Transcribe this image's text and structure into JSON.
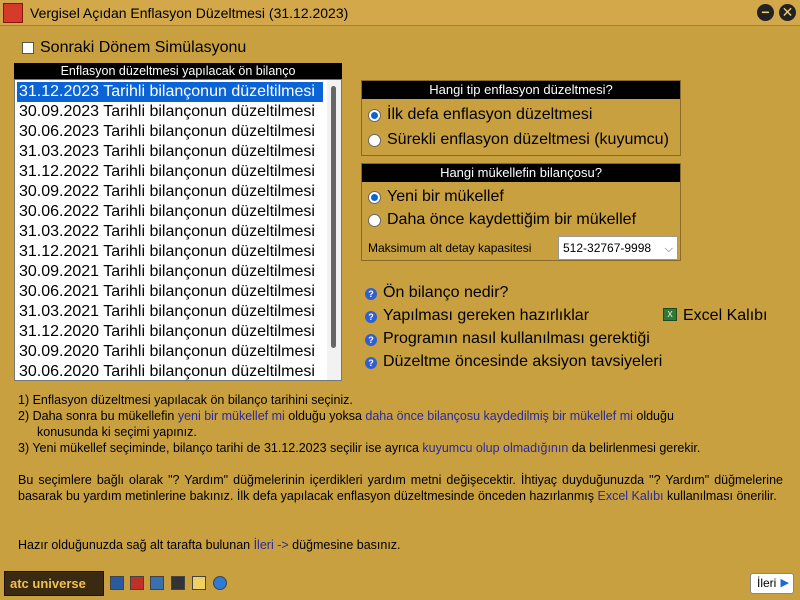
{
  "window": {
    "title": "Vergisel Açıdan Enflasyon Düzeltmesi (31.12.2023)",
    "minimize_glyph": "−",
    "close_glyph": "✕"
  },
  "simulation": {
    "label": "Sonraki Dönem Simülasyonu",
    "checked": false
  },
  "balance_list": {
    "header": "Enflasyon düzeltmesi yapılacak ön bilanço",
    "selected_index": 0,
    "items": [
      "31.12.2023 Tarihli bilançonun düzeltilmesi",
      "30.09.2023 Tarihli bilançonun düzeltilmesi",
      "30.06.2023 Tarihli bilançonun düzeltilmesi",
      "31.03.2023 Tarihli bilançonun düzeltilmesi",
      "31.12.2022 Tarihli bilançonun düzeltilmesi",
      "30.09.2022 Tarihli bilançonun düzeltilmesi",
      "30.06.2022 Tarihli bilançonun düzeltilmesi",
      "31.03.2022 Tarihli bilançonun düzeltilmesi",
      "31.12.2021 Tarihli bilançonun düzeltilmesi",
      "30.09.2021 Tarihli bilançonun düzeltilmesi",
      "30.06.2021 Tarihli bilançonun düzeltilmesi",
      "31.03.2021 Tarihli bilançonun düzeltilmesi",
      "31.12.2020 Tarihli bilançonun düzeltilmesi",
      "30.09.2020 Tarihli bilançonun düzeltilmesi",
      "30.06.2020 Tarihli bilançonun düzeltilmesi"
    ]
  },
  "type_panel": {
    "header": "Hangi tip enflasyon düzeltmesi?",
    "options": [
      "İlk defa enflasyon düzeltmesi",
      "Sürekli enflasyon düzeltmesi (kuyumcu)"
    ],
    "selected": 0
  },
  "taxpayer_panel": {
    "header": "Hangi mükellefin bilançosu?",
    "options": [
      "Yeni bir mükellef",
      "Daha önce kaydettiğim bir mükellef"
    ],
    "selected": 0,
    "capacity_label": "Maksimum alt detay kapasitesi",
    "capacity_value": "512-32767-9998",
    "chevron_glyph": "⌵"
  },
  "help_links": {
    "icon_glyph": "?",
    "items": [
      "Ön bilanço nedir?",
      "Yapılması gereken hazırlıklar",
      "Programın nasıl kullanılması gerektiği",
      "Düzeltme öncesinde aksiyon tavsiyeleri"
    ],
    "excel_icon_glyph": "X",
    "excel_label": "Excel Kalıbı"
  },
  "instructions": {
    "line1": "1) Enflasyon düzeltmesi yapılacak ön bilanço tarihini seçiniz.",
    "line2_a": "2)  Daha sonra bu mükellefin ",
    "line2_b": "yeni bir mükellef mi",
    "line2_c": " olduğu yoksa ",
    "line2_d": "daha önce bilançosu kaydedilmiş bir mükellef mi",
    "line2_e": " olduğu",
    "line2_f": "konusunda ki seçimi yapınız.",
    "line3_a": "3) Yeni mükellef seçiminde, bilanço tarihi de 31.12.2023 seçilir ise ayrıca ",
    "line3_b": "kuyumcu olup olmadığının",
    "line3_c": " da belirlenmesi gerekir.",
    "para_a": "Bu seçimlere bağlı olarak  \"? Yardım\" düğmelerinin içerdikleri yardım metni değişecektir. İhtiyaç duyduğunuzda  \"? Yardım\" düğmelerine basarak bu yardım metinlerine bakınız. İlk defa yapılacak enflasyon düzeltmesinde önceden hazırlanmış ",
    "para_b": "Excel Kalıbı",
    "para_c": " kullanılması önerilir.",
    "final_a": "Hazır olduğunuzda sağ alt tarafta bulunan ",
    "final_b": "İleri ->",
    "final_c": " düğmesine basınız."
  },
  "footer": {
    "logo": "atc universe",
    "next_label": "İleri",
    "next_arrow_glyph": "▶"
  }
}
